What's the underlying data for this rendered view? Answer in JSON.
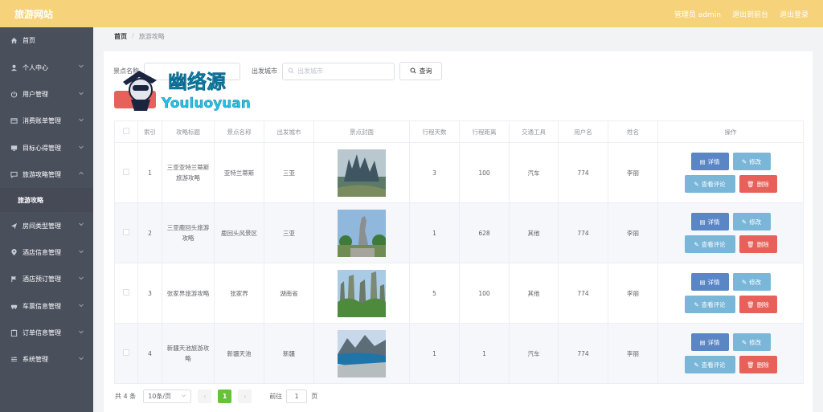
{
  "header": {
    "brand": "旅游网站",
    "admin_label": "管理员 admin",
    "to_front_label": "退出到前台",
    "logout_label": "退出登录"
  },
  "sidebar": {
    "items": [
      {
        "label": "首页",
        "icon": "home-icon"
      },
      {
        "label": "个人中心",
        "icon": "user-icon"
      },
      {
        "label": "用户管理",
        "icon": "power-icon"
      },
      {
        "label": "消费账单管理",
        "icon": "bill-icon"
      },
      {
        "label": "目标心得管理",
        "icon": "monitor-icon"
      },
      {
        "label": "旅游攻略管理",
        "icon": "chat-icon"
      },
      {
        "label": "房间类型管理",
        "icon": "send-icon"
      },
      {
        "label": "酒店信息管理",
        "icon": "location-icon"
      },
      {
        "label": "酒店预订管理",
        "icon": "flag-icon"
      },
      {
        "label": "车票信息管理",
        "icon": "car-icon"
      },
      {
        "label": "订单信息管理",
        "icon": "clipboard-icon"
      },
      {
        "label": "系统管理",
        "icon": "sliders-icon"
      }
    ],
    "submenu": {
      "label": "旅游攻略"
    }
  },
  "breadcrumb": {
    "home": "首页",
    "separator": "/",
    "current": "旅游攻略"
  },
  "search": {
    "spot_label": "景点名称",
    "city_label": "出发城市",
    "city_placeholder": "出发城市",
    "query_label": "查询"
  },
  "watermark": {
    "text_cn": "幽络源",
    "text_en": "Youluoyuan"
  },
  "table": {
    "columns": [
      "索引",
      "攻略标题",
      "景点名称",
      "出发城市",
      "景点封面",
      "行程天数",
      "行程距离",
      "交通工具",
      "用户名",
      "姓名",
      "操作"
    ],
    "rows": [
      {
        "index": "1",
        "title": "三亚亚特兰蒂斯旅游攻略",
        "spot": "亚特兰蒂斯",
        "city": "三亚",
        "days": "3",
        "distance": "100",
        "transport": "汽车",
        "username": "774",
        "name": "李丽"
      },
      {
        "index": "2",
        "title": "三亚鹿回头旅游攻略",
        "spot": "鹿回头风景区",
        "city": "三亚",
        "days": "1",
        "distance": "628",
        "transport": "其他",
        "username": "774",
        "name": "李丽"
      },
      {
        "index": "3",
        "title": "张家界旅游攻略",
        "spot": "张家界",
        "city": "湖南省",
        "days": "5",
        "distance": "100",
        "transport": "其他",
        "username": "774",
        "name": "李丽"
      },
      {
        "index": "4",
        "title": "新疆天池旅游攻略",
        "spot": "新疆天池",
        "city": "新疆",
        "days": "1",
        "distance": "1",
        "transport": "汽车",
        "username": "774",
        "name": "李丽"
      }
    ],
    "actions": {
      "detail": "详情",
      "edit": "修改",
      "comment": "查看评论",
      "delete": "删除"
    }
  },
  "pagination": {
    "total": "共 4 条",
    "page_size": "10条/页",
    "current_page": "1",
    "goto_prefix": "前往",
    "goto_value": "1",
    "goto_suffix": "页"
  },
  "colors": {
    "header": "#f6d27a",
    "sidebar": "#4a4f5c",
    "danger": "#e8605a",
    "primary": "#5b86c5",
    "info": "#7ab6d8",
    "success": "#67c23a"
  }
}
